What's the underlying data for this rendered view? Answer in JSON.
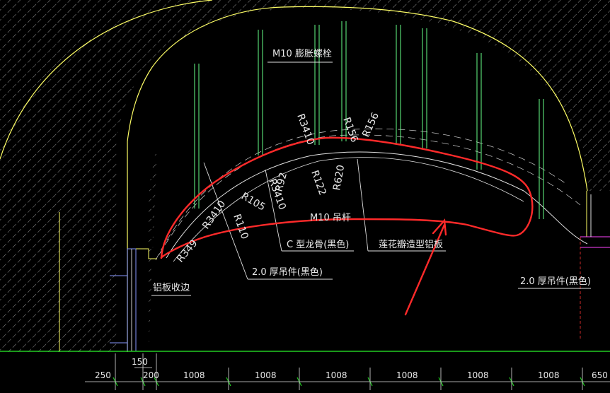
{
  "labels": {
    "bolt": "M10 膨胀螺栓",
    "rod": "M10 吊杆",
    "keel": "C 型龙骨(黑色)",
    "lotus": "莲花瓣造型铝板",
    "hanger_left": "2.0 厚吊件(黑色)",
    "hanger_right": "2.0 厚吊件(黑色)",
    "edge": "铝板收边"
  },
  "radii": [
    "R349",
    "R3410",
    "R110",
    "R105",
    "R3410",
    "R92",
    "R122",
    "R620",
    "R3410",
    "R156",
    "R156"
  ],
  "dimensions": [
    "250",
    "150",
    "200",
    "1008",
    "1008",
    "1008",
    "1008",
    "1008",
    "1008",
    "650"
  ],
  "colors": {
    "wall": "#ffff66",
    "hatch": "#cfcfcf",
    "hanger": "#66ff88",
    "arch": "#e0e0e0",
    "markup": "#ff2a2a",
    "ground": "#22cc22",
    "dim_tick": "#22cc22",
    "steel": "#8899ff",
    "magenta": "#ff44ff"
  }
}
